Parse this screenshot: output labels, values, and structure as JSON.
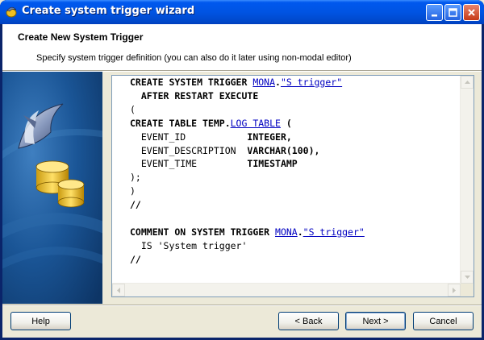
{
  "window": {
    "title": "Create system trigger wizard"
  },
  "header": {
    "title": "Create New System Trigger",
    "subtitle": "Specify system trigger definition (you can also do it later using non-modal editor)"
  },
  "editor": {
    "lines": [
      {
        "kw": "CREATE SYSTEM TRIGGER ",
        "link1": "MONA",
        "mid": ".",
        "link2": "\"S trigger\""
      },
      {
        "text": "  AFTER RESTART EXECUTE"
      },
      {
        "text": "("
      },
      {
        "kw": "CREATE TABLE TEMP.",
        "link1": "LOG TABLE",
        "tail": " ("
      },
      {
        "col": "  EVENT_ID",
        "type": "INTEGER,"
      },
      {
        "col": "  EVENT_DESCRIPTION",
        "type": "VARCHAR(100),"
      },
      {
        "col": "  EVENT_TIME",
        "type": "TIMESTAMP"
      },
      {
        "text": ");"
      },
      {
        "text": ")"
      },
      {
        "text": "//"
      },
      {
        "text": ""
      },
      {
        "kw": "COMMENT ON SYSTEM TRIGGER ",
        "link1": "MONA",
        "mid": ".",
        "link2": "\"S trigger\""
      },
      {
        "text": "  IS 'System trigger'"
      },
      {
        "text": "//"
      }
    ]
  },
  "buttons": {
    "help": "Help",
    "back": "< Back",
    "next": "Next >",
    "cancel": "Cancel"
  },
  "icons": {
    "app": "dolphin-db-icon",
    "side_art": "dolphin-database-illustration"
  },
  "colors": {
    "titlebar": "#0054e3",
    "keyword_link": "#0000c0",
    "side_panel": "#16487d"
  }
}
